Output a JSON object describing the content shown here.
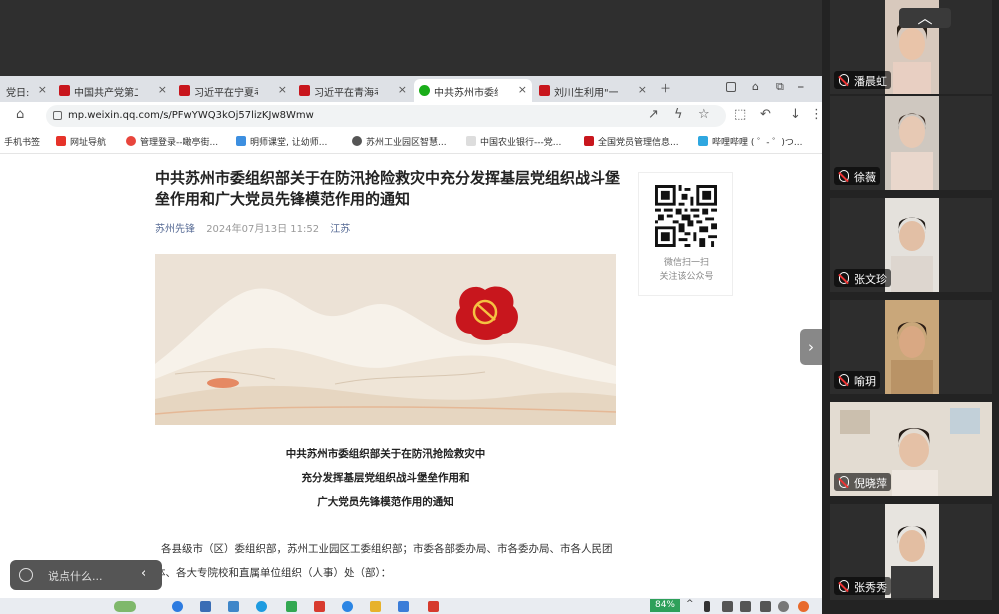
{
  "tabs": [
    {
      "label": "党日: "
    },
    {
      "label": "中国共产党第二十"
    },
    {
      "label": "习近平在宁夏考察"
    },
    {
      "label": "习近平在青海考察"
    },
    {
      "label": "中共苏州市委组织",
      "active": true
    },
    {
      "label": "刘川生利用\"一把手"
    }
  ],
  "addressbar": {
    "url": "mp.weixin.qq.com/s/PFwYWQ3kOj57lizKJw8Wmw"
  },
  "bookmarks": [
    "手机书签",
    "网址导航",
    "管理登录--瞰亭街...",
    "明师课堂, 让幼师...",
    "苏州工业园区智慧...",
    "中国农业银行---党...",
    "全国党员管理信息...",
    "哔哩哔哩 ( ゜- ゜)つ..."
  ],
  "article": {
    "title": "中共苏州市委组织部关于在防汛抢险救灾中充分发挥基层党组织战斗堡垒作用和广大党员先锋模范作用的通知",
    "account": "苏州先锋",
    "datetime": "2024年07月13日 11:52",
    "location": "江苏",
    "heading_lines": [
      "中共苏州市委组织部关于在防汛抢险救灾中",
      "充分发挥基层党组织战斗堡垒作用和",
      "广大党员先锋模范作用的通知"
    ],
    "body": "各县级市（区）委组织部，苏州工业园区工委组织部；市委各部委办局、市各委办局、市各人民团体、各大专院校和直属单位组织（人事）处（部）："
  },
  "qr": {
    "line1": "微信扫一扫",
    "line2": "关注该公众号"
  },
  "comment": {
    "placeholder": "说点什么..."
  },
  "taskbar": {
    "battery": "84%"
  },
  "participants": [
    {
      "name": "潘晨虹"
    },
    {
      "name": "徐薇"
    },
    {
      "name": "张文珍"
    },
    {
      "name": "喻玥"
    },
    {
      "name": "倪晓萍"
    },
    {
      "name": "张秀秀"
    }
  ],
  "icons": {
    "collapse": "chevron-up-icon",
    "next": "chevron-right-icon",
    "mic": "muted-mic-icon"
  },
  "colors": {
    "party_red": "#c8161d",
    "wechat_green": "#1aad19",
    "link_blue": "#576b95"
  }
}
